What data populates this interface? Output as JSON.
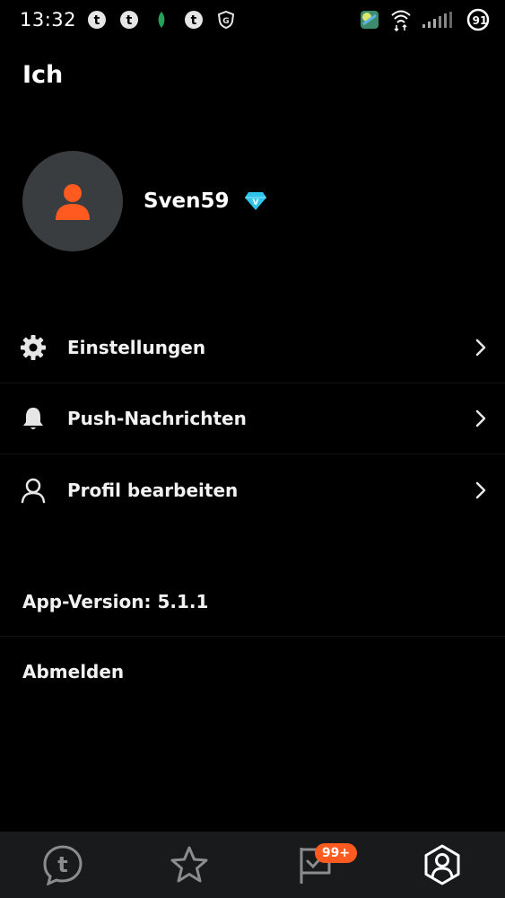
{
  "status_bar": {
    "time": "13:32",
    "left_icons": [
      "tapatalk-icon",
      "tapatalk-icon",
      "leaf-icon",
      "tapatalk-icon",
      "shield-icon"
    ],
    "right_icons": [
      "weather-icon",
      "wifi-icon",
      "signal-icon",
      "battery-icon"
    ],
    "battery_level": "91"
  },
  "header": {
    "title": "Ich"
  },
  "profile": {
    "username": "Sven59",
    "badge": "V"
  },
  "menu": {
    "items": [
      {
        "label": "Einstellungen",
        "icon": "gear-icon"
      },
      {
        "label": "Push-Nachrichten",
        "icon": "bell-icon"
      },
      {
        "label": "Profil bearbeiten",
        "icon": "user-outline-icon"
      }
    ]
  },
  "info": {
    "version": "App-Version: 5.1.1",
    "logout": "Abmelden"
  },
  "bottom_nav": {
    "items": [
      {
        "icon": "tapatalk-icon"
      },
      {
        "icon": "star-icon"
      },
      {
        "icon": "flag-icon",
        "badge": "99+"
      },
      {
        "icon": "profile-icon"
      }
    ]
  },
  "colors": {
    "background": "#000000",
    "accent": "#ff5a1f",
    "avatar_bg": "#3a3d40",
    "nav_bg": "#181a1c",
    "badge_blue": "#2fc4ea"
  }
}
